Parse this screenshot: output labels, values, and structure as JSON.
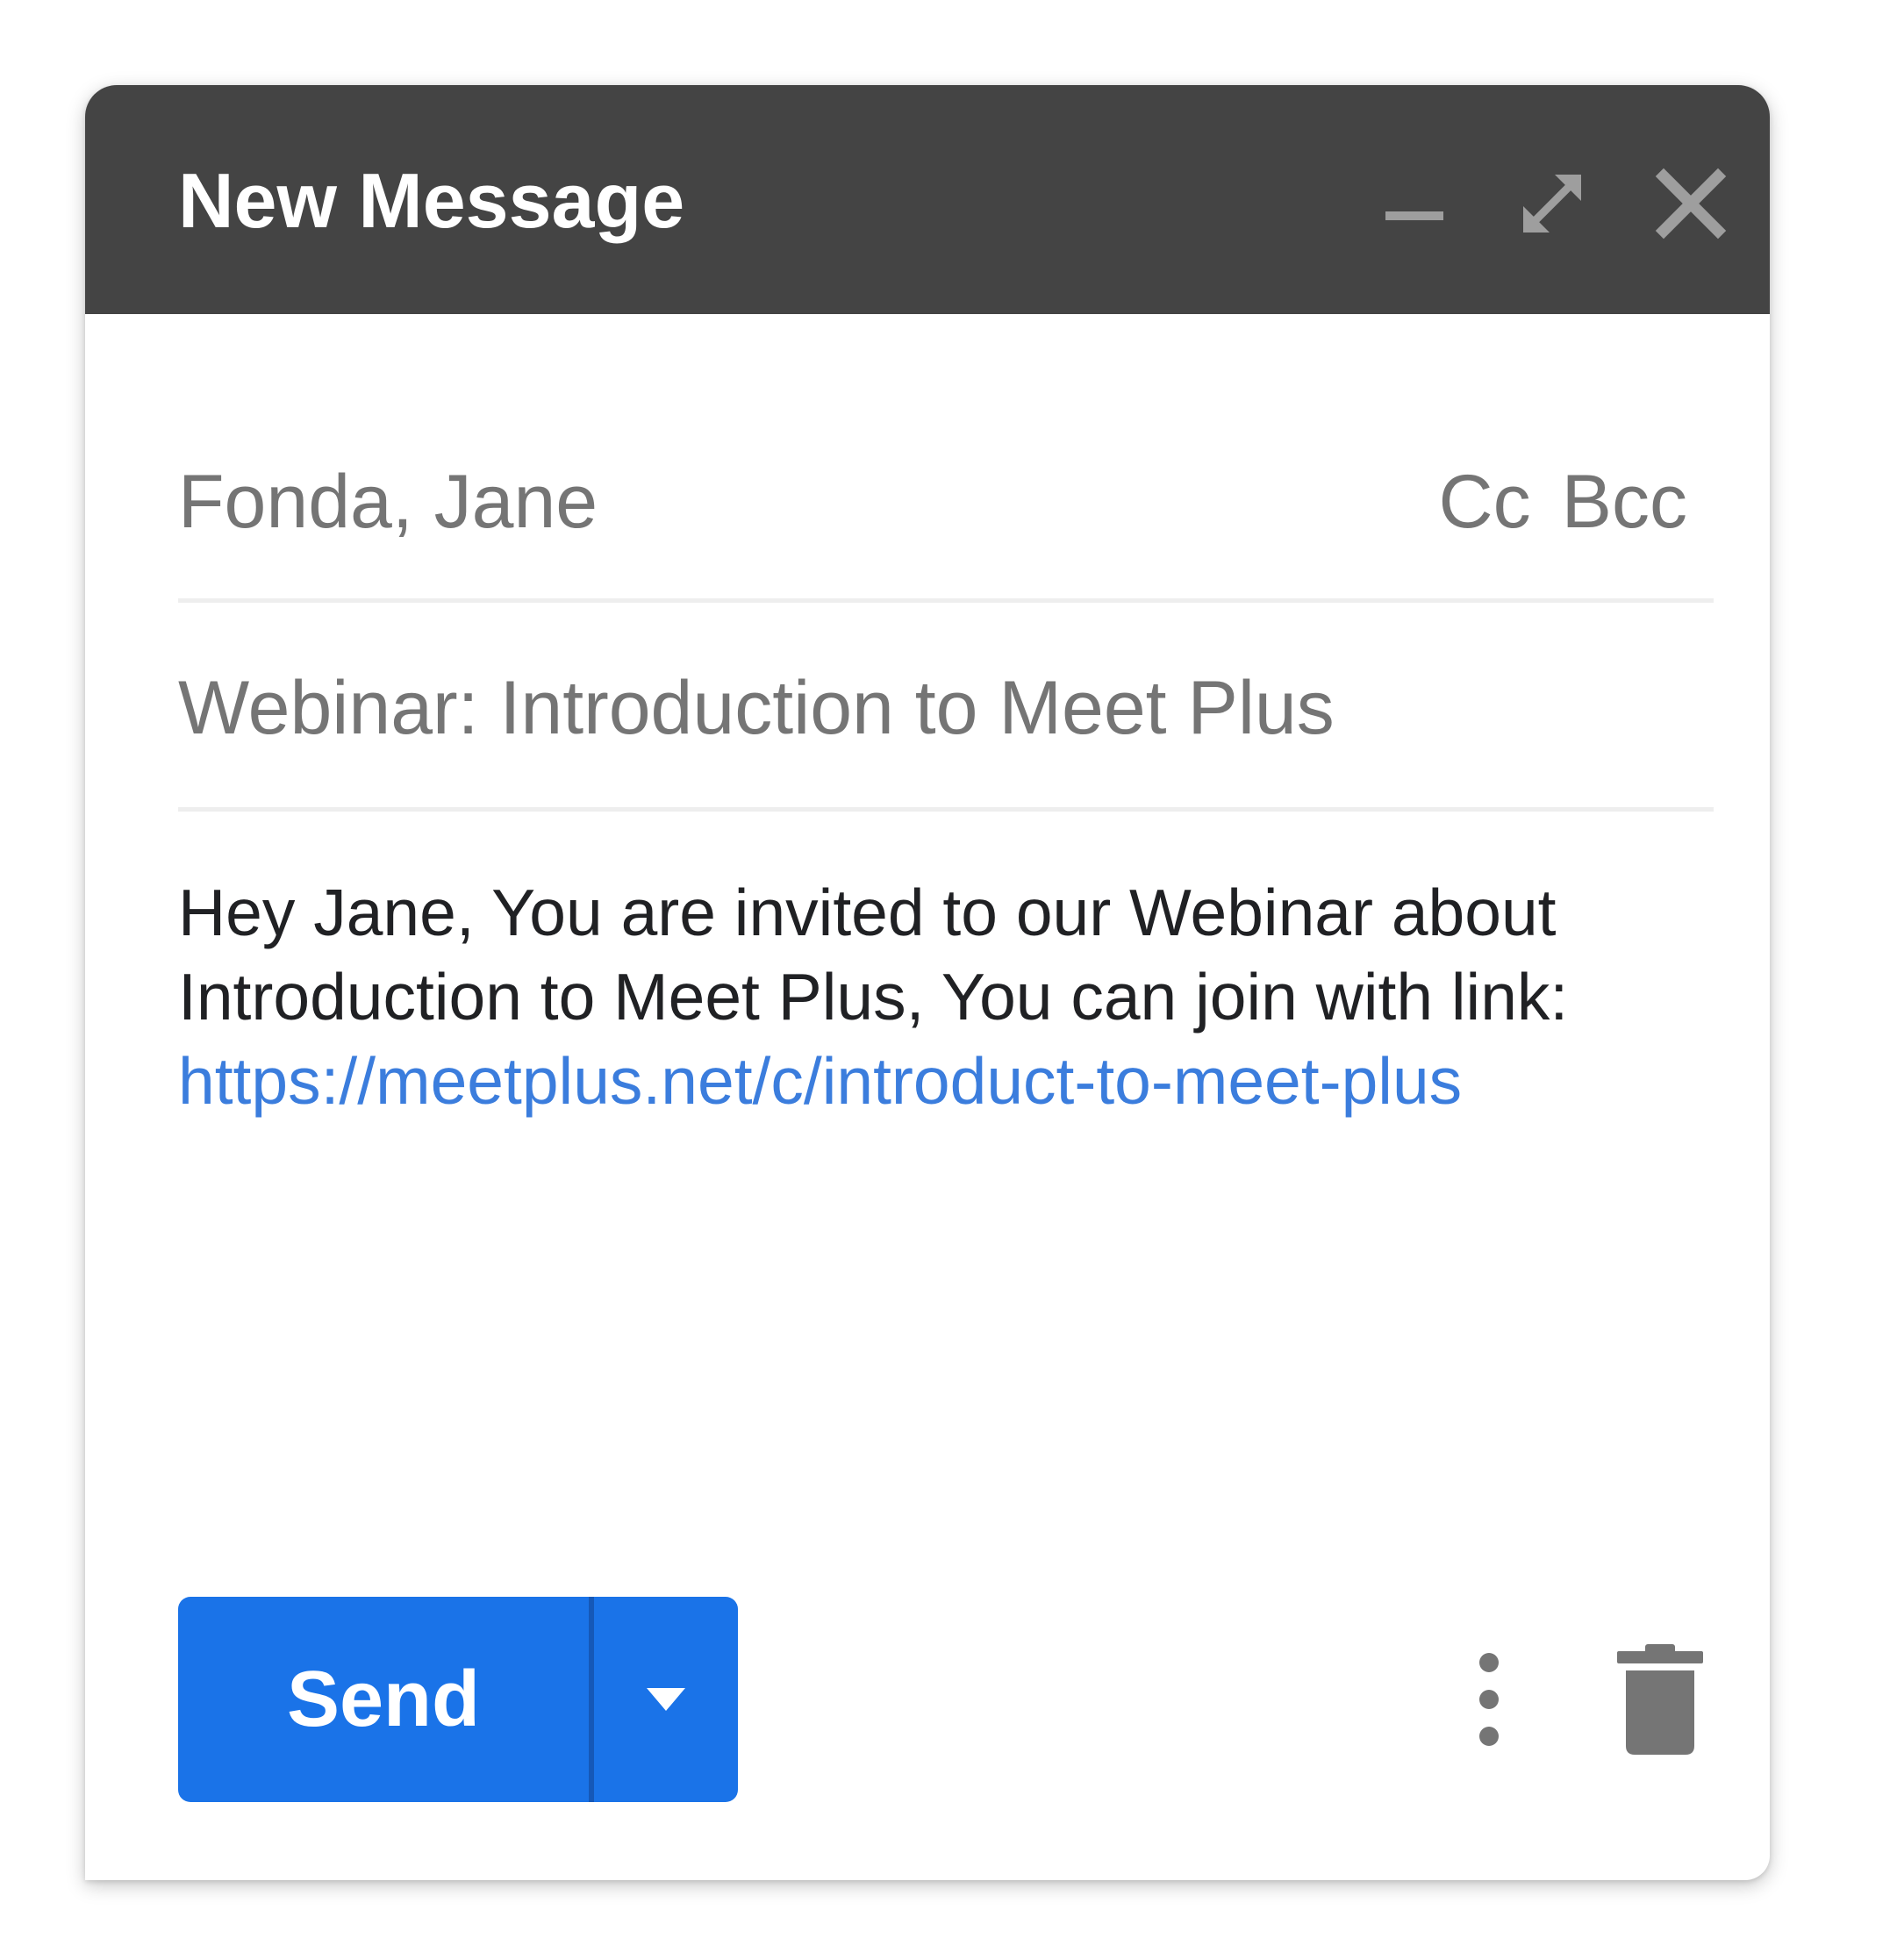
{
  "window": {
    "title": "New Message"
  },
  "header_controls": {
    "minimize_icon": "minimize-icon",
    "expand_icon": "expand-icon",
    "close_icon": "close-icon",
    "icon_color": "#9e9e9e"
  },
  "recipients": {
    "to": "Fonda, Jane",
    "cc_label": "Cc",
    "bcc_label": "Bcc"
  },
  "subject": "Webinar: Introduction to Meet Plus",
  "body": {
    "line1": "Hey Jane, You are invited to our Webinar about",
    "line2": "Introduction to Meet Plus, You can join with link:",
    "link": "https://meetplus.net/c/introduct-to-meet-plus"
  },
  "footer": {
    "send_label": "Send",
    "send_options_icon": "caret-down-icon",
    "more_options_icon": "more-vertical-icon",
    "discard_icon": "trash-icon"
  },
  "colors": {
    "header_bg": "#444444",
    "send_button": "#1a73e8",
    "link": "#3b7ddd",
    "muted_text": "#757575"
  }
}
